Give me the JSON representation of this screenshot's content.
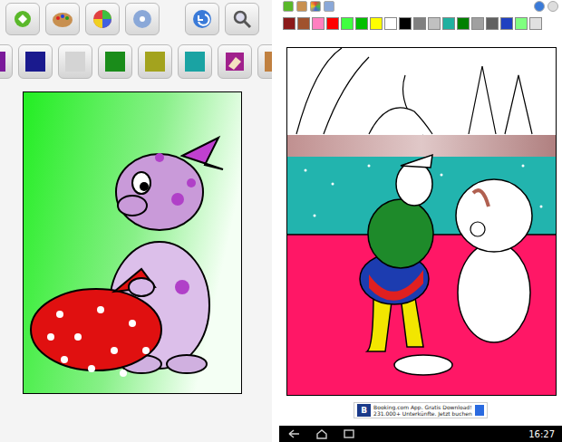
{
  "left_app": {
    "palette": [
      {
        "kind": "color",
        "color": "#7a1a9a"
      },
      {
        "kind": "color",
        "color": "#1a1a8e"
      },
      {
        "kind": "color",
        "color": "#d4d4d4"
      },
      {
        "kind": "color",
        "color": "#1a8c1a"
      },
      {
        "kind": "color",
        "color": "#a3a31e"
      },
      {
        "kind": "color",
        "color": "#1aa3a3"
      },
      {
        "kind": "eraser",
        "color": "#a0208c"
      },
      {
        "kind": "color",
        "color": "#c08040"
      }
    ]
  },
  "right_app": {
    "palette": [
      {
        "color": "#8b1a1a"
      },
      {
        "color": "#a0522d"
      },
      {
        "color": "#ff80c0"
      },
      {
        "color": "#ff0000"
      },
      {
        "color": "#40ff40"
      },
      {
        "color": "#00c000"
      },
      {
        "color": "#ffff00"
      },
      {
        "color": "#ffffff"
      },
      {
        "color": "#000000"
      },
      {
        "color": "#808080"
      },
      {
        "color": "#c0c0c0"
      },
      {
        "color": "#20b0a0"
      },
      {
        "color": "#008000"
      },
      {
        "color": "#a0a0a0"
      },
      {
        "color": "#606060"
      },
      {
        "color": "#2040c0"
      },
      {
        "color": "#80ff80"
      },
      {
        "color": "#e0e0e0"
      }
    ]
  },
  "ad": {
    "logo": "B",
    "title": "Booking.com App. Gratis Download!",
    "subtitle": "231.000+ Unterkünfte. Jetzt buchen"
  },
  "status_bar": {
    "time": "16:27"
  }
}
